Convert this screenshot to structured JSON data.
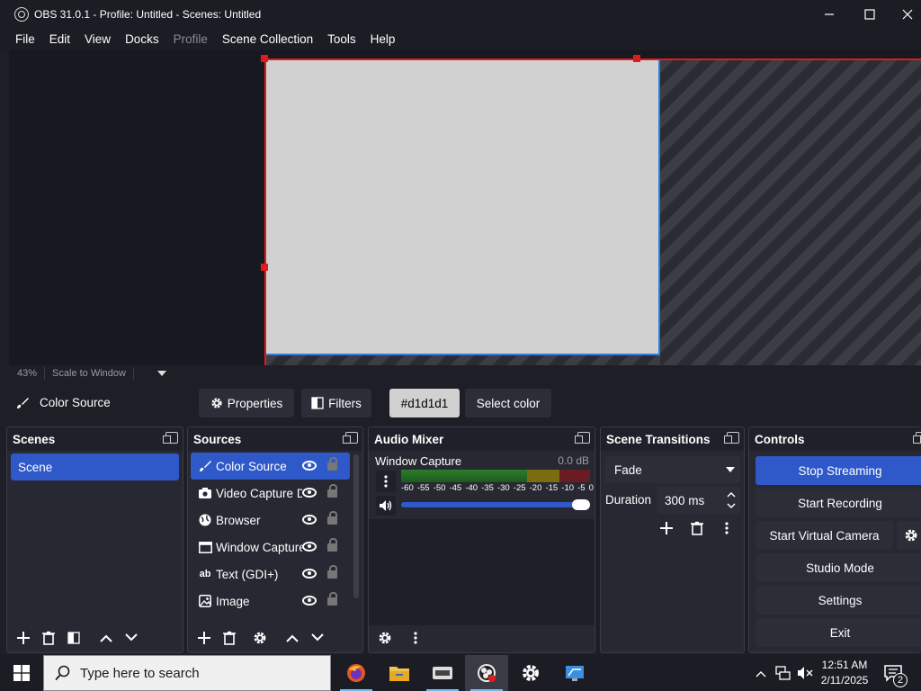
{
  "titlebar": {
    "title": "OBS 31.0.1 - Profile: Untitled - Scenes: Untitled"
  },
  "menu": [
    {
      "label": "File",
      "enabled": true
    },
    {
      "label": "Edit",
      "enabled": true
    },
    {
      "label": "View",
      "enabled": true
    },
    {
      "label": "Docks",
      "enabled": true
    },
    {
      "label": "Profile",
      "enabled": false
    },
    {
      "label": "Scene Collection",
      "enabled": true
    },
    {
      "label": "Tools",
      "enabled": true
    },
    {
      "label": "Help",
      "enabled": true
    }
  ],
  "preview": {
    "canvas_color": "#d1d1d1",
    "zoom": "43%",
    "scale_mode": "Scale to Window"
  },
  "context": {
    "source_label": "Color Source",
    "properties": "Properties",
    "filters": "Filters",
    "color_value": "#d1d1d1",
    "select_color": "Select color"
  },
  "scenes": {
    "title": "Scenes",
    "items": [
      "Scene"
    ]
  },
  "sources": {
    "title": "Sources",
    "items": [
      {
        "name": "Color Source",
        "icon": "brush-icon",
        "selected": true
      },
      {
        "name": "Video Capture Device",
        "icon": "camera-icon",
        "selected": false
      },
      {
        "name": "Browser",
        "icon": "globe-icon",
        "selected": false
      },
      {
        "name": "Window Capture",
        "icon": "window-icon",
        "selected": false
      },
      {
        "name": "Text (GDI+)",
        "icon": "text-icon",
        "selected": false
      },
      {
        "name": "Image",
        "icon": "image-icon",
        "selected": false
      }
    ]
  },
  "mixer": {
    "title": "Audio Mixer",
    "channel": "Window Capture",
    "level": "0.0 dB",
    "scale": [
      "-60",
      "-55",
      "-50",
      "-45",
      "-40",
      "-35",
      "-30",
      "-25",
      "-20",
      "-15",
      "-10",
      "-5",
      "0"
    ],
    "volume": 1.0
  },
  "transitions": {
    "title": "Scene Transitions",
    "type": "Fade",
    "duration_label": "Duration",
    "duration": "300 ms"
  },
  "controls": {
    "title": "Controls",
    "stop_streaming": "Stop Streaming",
    "start_recording": "Start Recording",
    "start_virtual_camera": "Start Virtual Camera",
    "studio_mode": "Studio Mode",
    "settings": "Settings",
    "exit": "Exit"
  },
  "taskbar": {
    "search_placeholder": "Type here to search",
    "time": "12:51 AM",
    "date": "2/11/2025",
    "notification_count": "2"
  },
  "colors": {
    "accent": "#2f58c8",
    "panel": "#272831",
    "background": "#1d1e26",
    "selection_red": "#e01b1b"
  }
}
